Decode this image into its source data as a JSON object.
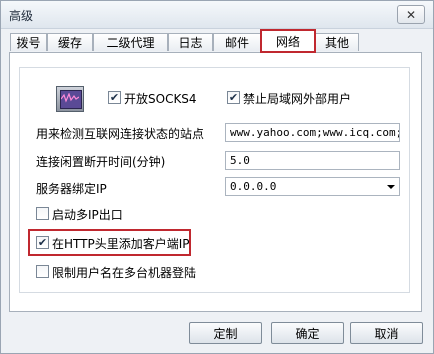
{
  "window": {
    "title": "高级",
    "close_glyph": "✕"
  },
  "tabs": [
    {
      "label": "拨号"
    },
    {
      "label": "缓存"
    },
    {
      "label": "二级代理"
    },
    {
      "label": "日志"
    },
    {
      "label": "邮件"
    },
    {
      "label": "网络",
      "active": true
    },
    {
      "label": "其他"
    }
  ],
  "network": {
    "icon": "network-monitor-icon",
    "socks4": {
      "label": "开放SOCKS4",
      "checked": true
    },
    "block_lan": {
      "label": "禁止局域网外部用户",
      "checked": true
    },
    "check_site": {
      "label": "用来检测互联网连接状态的站点",
      "value": "www.yahoo.com;www.icq.com;ww"
    },
    "idle_timeout": {
      "label": "连接闲置断开时间(分钟)",
      "value": "5.0"
    },
    "bind_ip": {
      "label": "服务器绑定IP",
      "value": "0.0.0.0"
    },
    "multi_ip": {
      "label": "启动多IP出口",
      "checked": false
    },
    "add_client_ip": {
      "label": "在HTTP头里添加客户端IP",
      "checked": true
    },
    "limit_multi_login": {
      "label": "限制用户名在多台机器登陆",
      "checked": false
    }
  },
  "check_glyph": "✔",
  "buttons": {
    "custom": "定制",
    "ok": "确定",
    "cancel": "取消"
  },
  "colors": {
    "highlight": "#c0282f"
  }
}
